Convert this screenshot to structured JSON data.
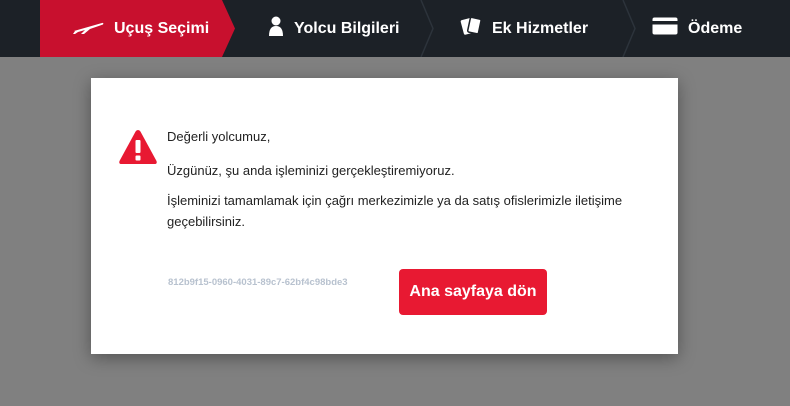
{
  "stepper": {
    "steps": [
      {
        "label": "Uçuş Seçimi",
        "icon": "plane-icon",
        "active": true
      },
      {
        "label": "Yolcu Bilgileri",
        "icon": "person-icon",
        "active": false
      },
      {
        "label": "Ek Hizmetler",
        "icon": "cards-icon",
        "active": false
      },
      {
        "label": "Ödeme",
        "icon": "credit-card-icon",
        "active": false
      }
    ],
    "active_color": "#c8102e",
    "bar_color": "#1c2127"
  },
  "modal": {
    "icon": "warning-triangle-icon",
    "greeting": "Değerli yolcumuz,",
    "apology": "Üzgünüz, şu anda işleminizi gerçekleştiremiyoruz.",
    "instruction": "İşleminizi tamamlamak için çağrı merkezimizle ya da satış ofislerimizle iletişime geçebilirsiniz.",
    "reference_id": "812b9f15-0960-4031-89c7-62bf4c98bde3",
    "home_button_label": "Ana sayfaya dön",
    "button_color": "#e81932"
  }
}
